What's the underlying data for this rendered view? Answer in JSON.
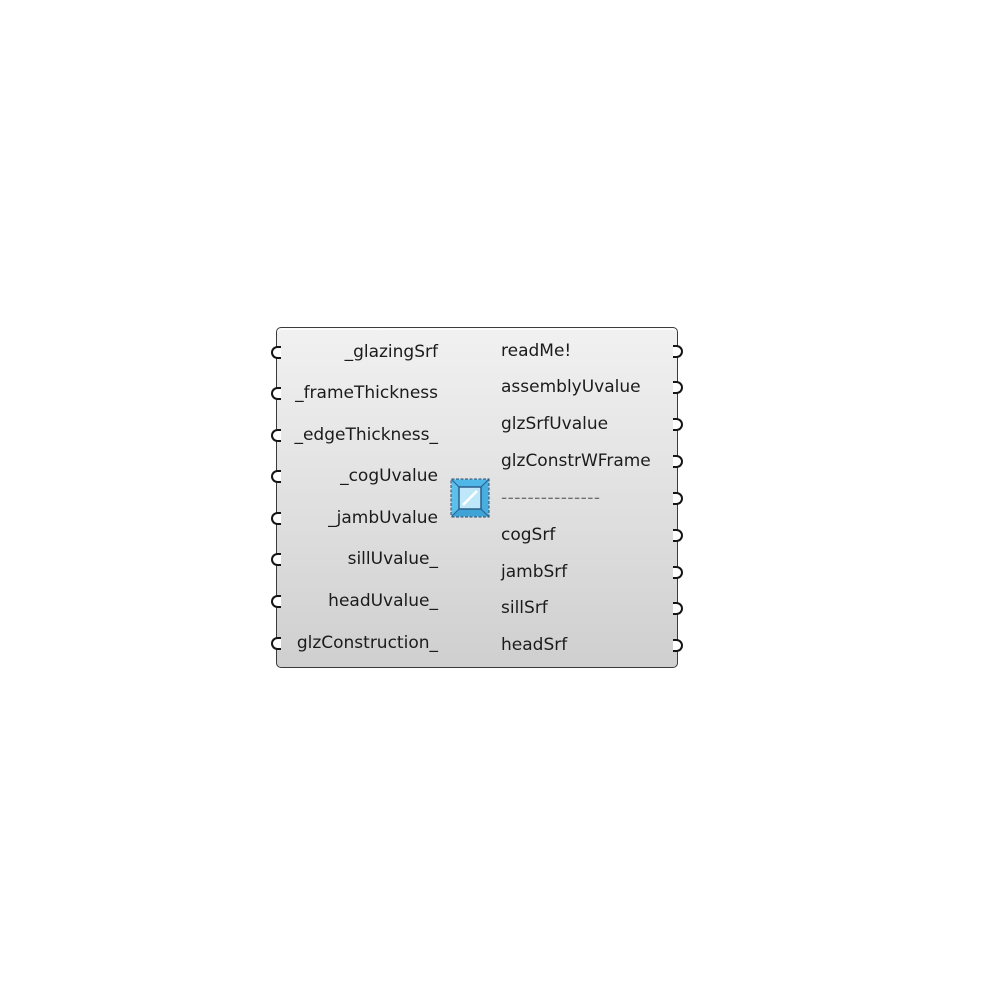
{
  "component": {
    "inputs": [
      {
        "label": "_glazingSrf"
      },
      {
        "label": "_frameThickness"
      },
      {
        "label": "_edgeThickness_"
      },
      {
        "label": "_cogUvalue"
      },
      {
        "label": "_jambUvalue"
      },
      {
        "label": "sillUvalue_"
      },
      {
        "label": "headUvalue_"
      },
      {
        "label": "glzConstruction_"
      }
    ],
    "outputs": [
      {
        "label": "readMe!"
      },
      {
        "label": "assemblyUvalue"
      },
      {
        "label": "glzSrfUvalue"
      },
      {
        "label": "glzConstrWFrame"
      },
      {
        "label": "---------------"
      },
      {
        "label": "cogSrf"
      },
      {
        "label": "jambSrf"
      },
      {
        "label": "sillSrf"
      },
      {
        "label": "headSrf"
      }
    ],
    "icon": "window-glazing-icon",
    "colors": {
      "body_top": "#f1f1f1",
      "body_bottom": "#cfcfcf",
      "border": "#3a3a3a",
      "icon_fill": "#7fd0f5",
      "icon_outline": "#2b5f8a"
    }
  }
}
